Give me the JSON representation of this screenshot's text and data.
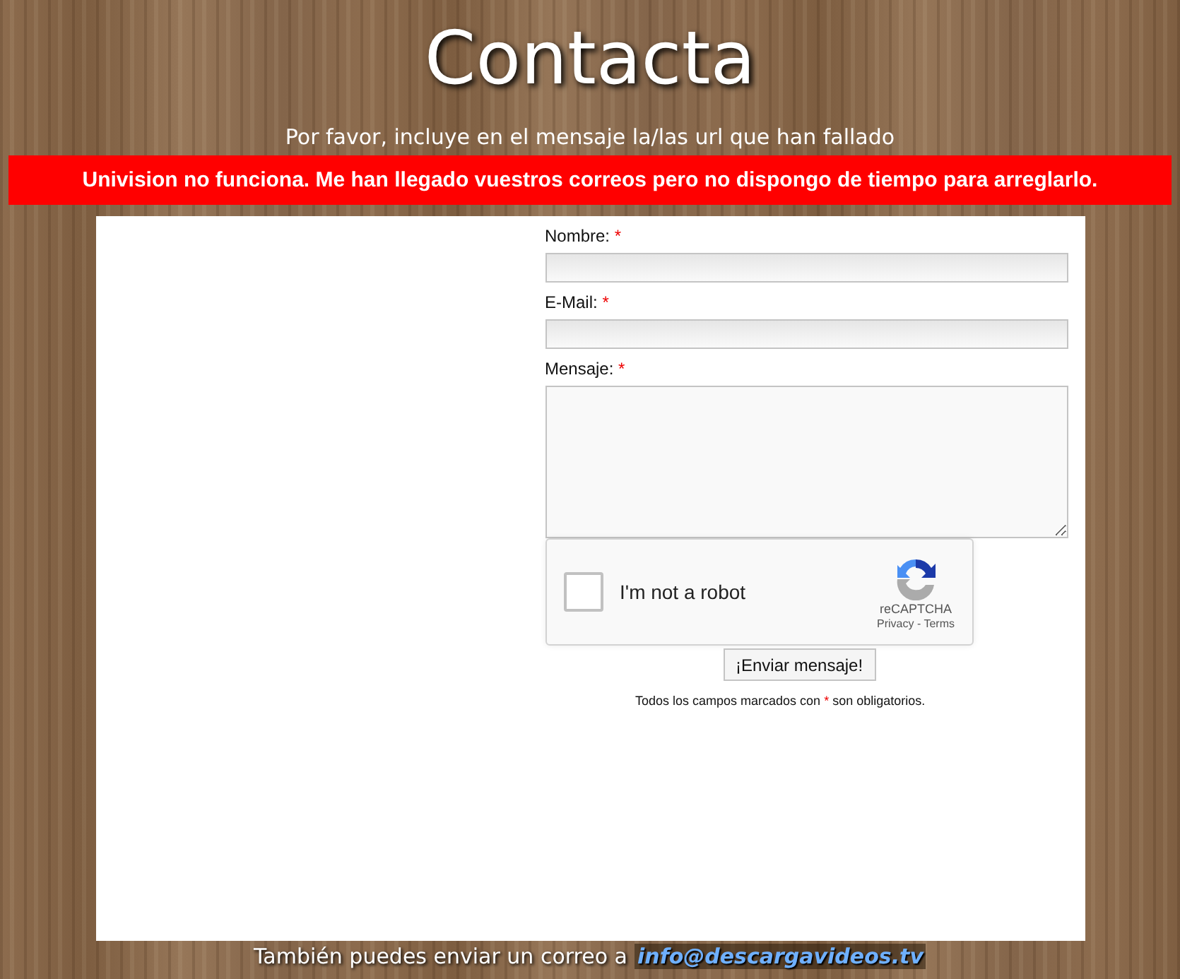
{
  "title": "Contacta",
  "subtitle": "Por favor, incluye en el mensaje la/las url que han fallado",
  "notice": "Univision no funciona. Me han llegado vuestros correos pero no dispongo de tiempo para arreglarlo.",
  "form": {
    "fields": [
      {
        "kind": "input",
        "label": "Nombre:",
        "required_mark": "*"
      },
      {
        "kind": "input",
        "label": "E-Mail:",
        "required_mark": "*"
      },
      {
        "kind": "textarea",
        "label": "Mensaje:",
        "required_mark": "*"
      }
    ],
    "captcha": {
      "label": "I'm not a robot",
      "checked": false,
      "brand": "reCAPTCHA",
      "privacy": "Privacy",
      "separator": "-",
      "terms": "Terms"
    },
    "submit": "¡Enviar mensaje!",
    "note": {
      "before": "Todos los campos marcados con",
      "mark": "*",
      "after": "son obligatorios."
    }
  },
  "footer": {
    "text": "También puedes enviar un correo a",
    "link": "info@descargavideos.tv"
  }
}
